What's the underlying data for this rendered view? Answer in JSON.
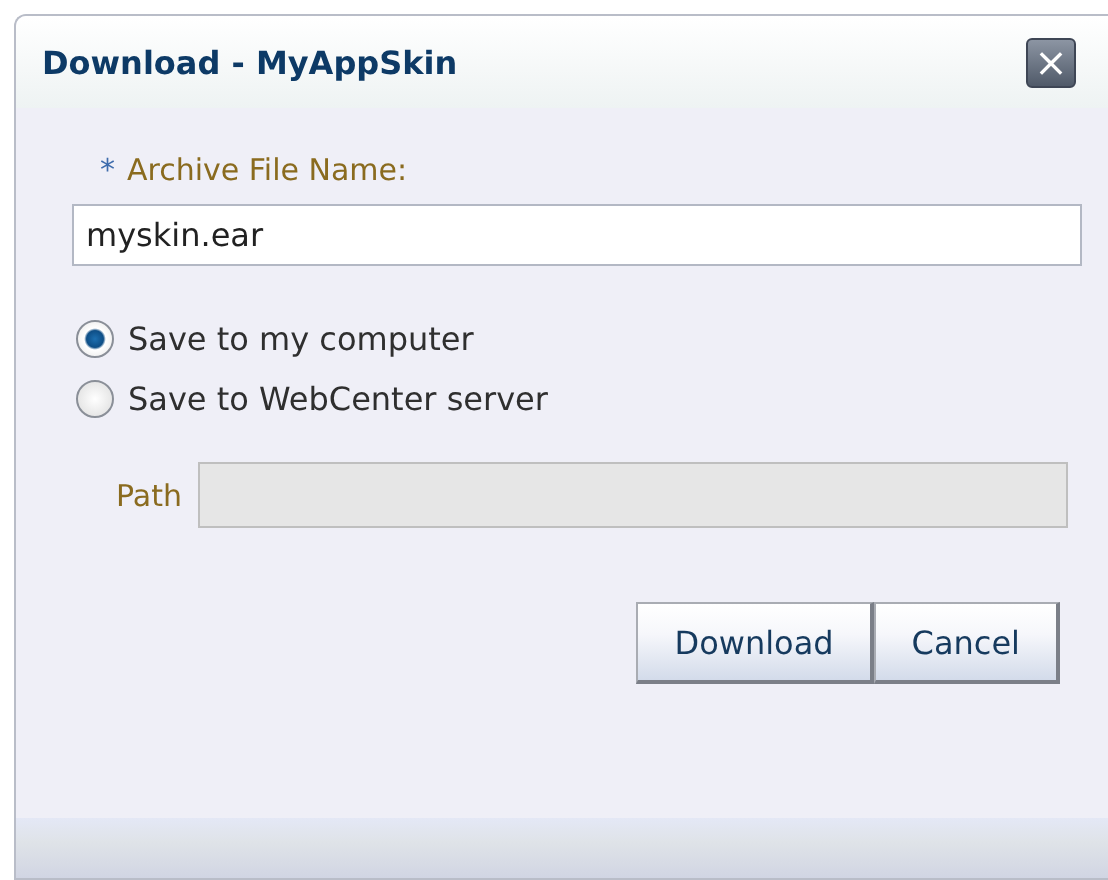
{
  "dialog": {
    "title": "Download - MyAppSkin",
    "close": "×"
  },
  "archive_field": {
    "required_mark": "*",
    "label": "Archive File Name:",
    "value": "myskin.ear"
  },
  "save_options": [
    {
      "label": "Save to my computer",
      "selected": true
    },
    {
      "label": "Save to WebCenter server",
      "selected": false
    }
  ],
  "path_field": {
    "label": "Path",
    "disabled": true
  },
  "buttons": [
    "Download",
    "Cancel"
  ]
}
